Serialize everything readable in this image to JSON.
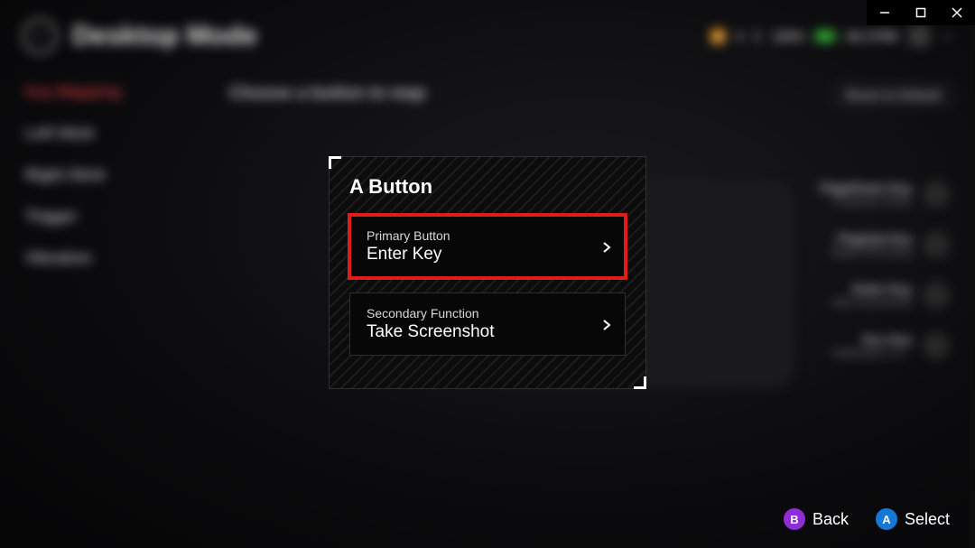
{
  "header": {
    "title": "Desktop Mode",
    "status": {
      "battery_pct": "100%",
      "time": "06:17PM"
    },
    "instruction": "Choose a button to map",
    "reset_label": "Reset to Default"
  },
  "sidebar": {
    "items": [
      {
        "label": "Key Mapping",
        "active": true
      },
      {
        "label": "Left Stick",
        "active": false
      },
      {
        "label": "Right Stick",
        "active": false
      },
      {
        "label": "Trigger",
        "active": false
      },
      {
        "label": "Vibration",
        "active": false
      }
    ]
  },
  "right_panel": {
    "items": [
      {
        "key": "PageDown Key",
        "desc": "Projection Mode"
      },
      {
        "key": "PageUp Key",
        "desc": "Begin Recording"
      },
      {
        "key": "Enter Key",
        "desc": "Take Screenshot"
      },
      {
        "key": "Esc Key",
        "desc": "Notification Ce..."
      }
    ]
  },
  "modal": {
    "title": "A Button",
    "cards": [
      {
        "label": "Primary Button",
        "value": "Enter Key",
        "selected": true
      },
      {
        "label": "Secondary Function",
        "value": "Take Screenshot",
        "selected": false
      }
    ]
  },
  "footer": {
    "back": {
      "glyph": "B",
      "label": "Back"
    },
    "select": {
      "glyph": "A",
      "label": "Select"
    }
  },
  "titlebar": {
    "minimize": "minimize",
    "maximize": "maximize",
    "close": "close"
  }
}
